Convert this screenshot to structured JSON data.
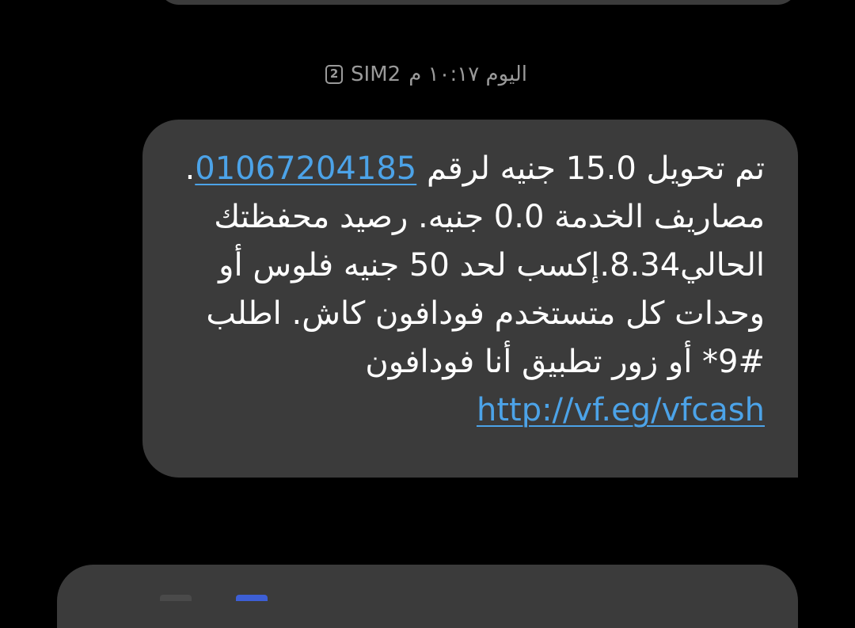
{
  "previous_message": {
    "visible": true
  },
  "message_meta": {
    "time": "اليوم ١٠:١٧ م",
    "sim_label": "SIM2",
    "sim_number": "2"
  },
  "message": {
    "part1": "تم تحويل 15.0 جنيه لرقم ",
    "phone_link": "01067204185",
    "part2": ". مصاريف الخدمة 0.0 جنيه. رصيد محفظتك الحالي8.34.إكسب لحد 50 جنيه فلوس أو وحدات كل متستخدم فودافون كاش. اطلب #9* أو زور تطبيق أنا فودافون ",
    "url_link": "http://vf.eg/vfcash"
  },
  "colors": {
    "background": "#000000",
    "bubble": "#3b3b3b",
    "link": "#4ca3e8",
    "meta_text": "#9a9a9a"
  }
}
